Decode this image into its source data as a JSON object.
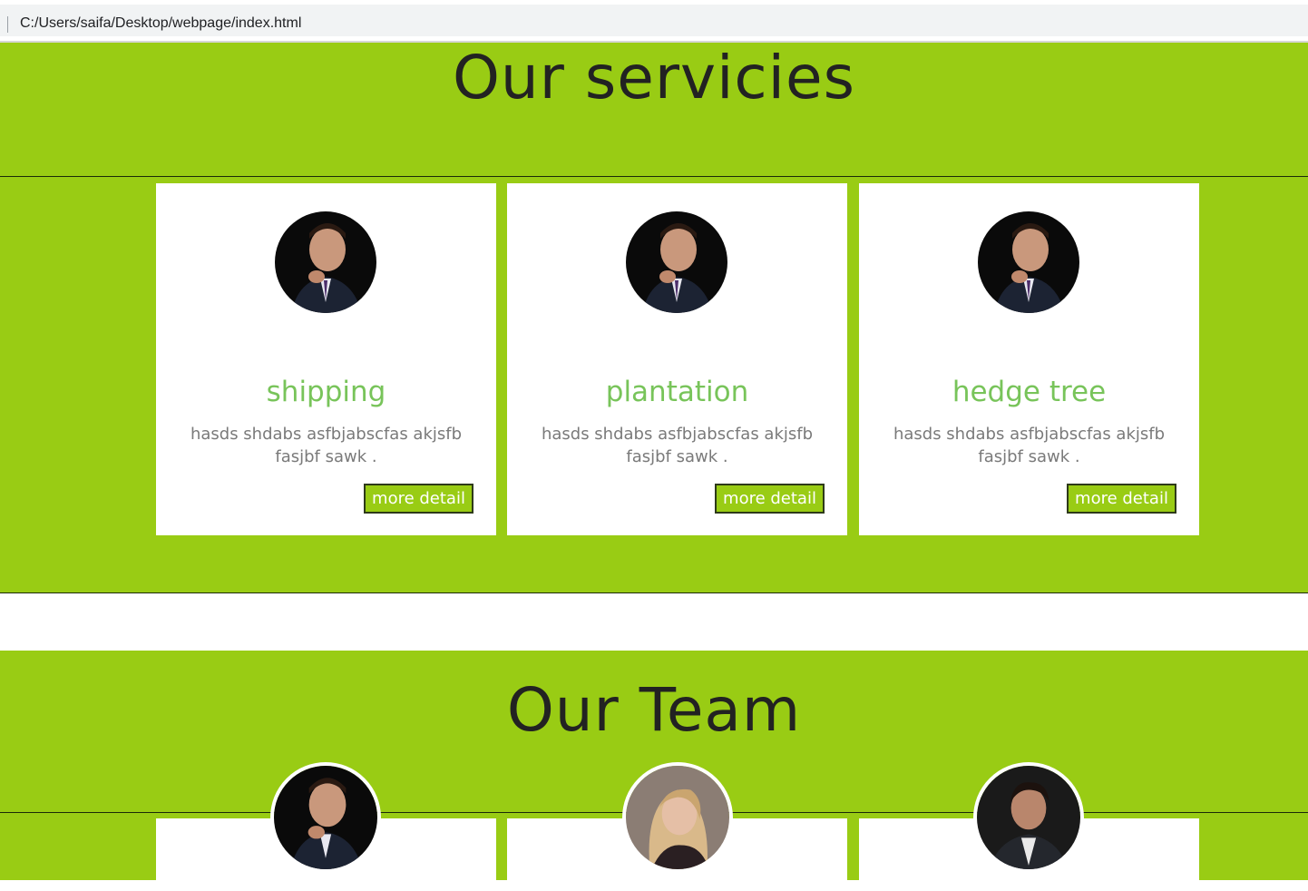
{
  "browser": {
    "url": "C:/Users/saifa/Desktop/webpage/index.html"
  },
  "services": {
    "title": "Our servicies",
    "cards": [
      {
        "title": "shipping",
        "text": "hasds shdabs asfbjabscfas akjsfb fasjbf sawk .",
        "button": "more detail"
      },
      {
        "title": "plantation",
        "text": "hasds shdabs asfbjabscfas akjsfb fasjbf sawk .",
        "button": "more detail"
      },
      {
        "title": "hedge tree",
        "text": "hasds shdabs asfbjabscfas akjsfb fasjbf sawk .",
        "button": "more detail"
      }
    ]
  },
  "team": {
    "title": "Our Team"
  },
  "colors": {
    "green": "#99cc14",
    "heading": "#78c45a",
    "body_text": "#7a7a7a"
  }
}
